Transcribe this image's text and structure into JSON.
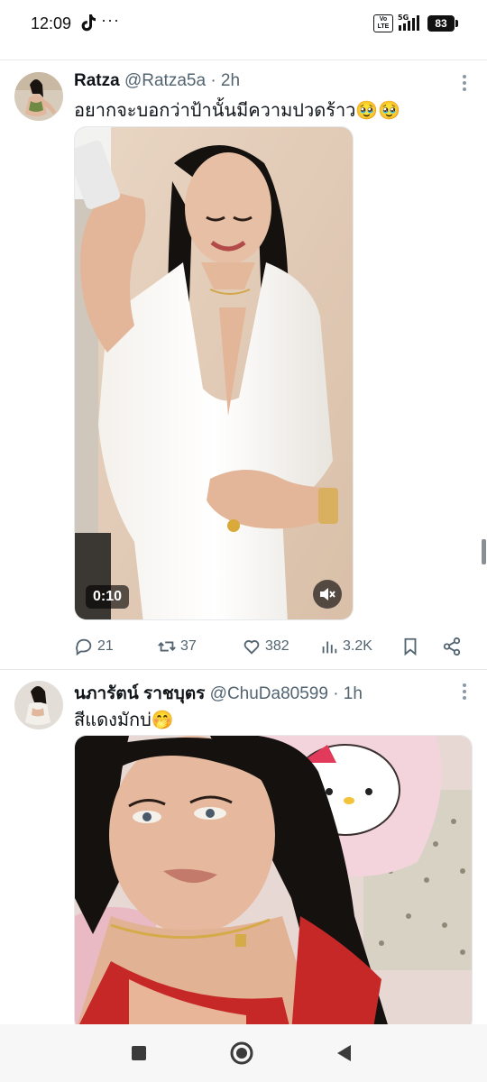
{
  "status_bar": {
    "time": "12:09",
    "app_icon": "tiktok-icon",
    "more_dots": "···",
    "volte": "Vo\nLTE",
    "network": "5G",
    "battery": "83"
  },
  "tweets": [
    {
      "name": "Ratza",
      "handle": "@Ratza5a",
      "time": "· 2h",
      "text": "อยากจะบอกว่าป้านั้นมีความปวดร้าว🥹🥹",
      "media": {
        "type": "video",
        "duration": "0:10",
        "muted": true
      },
      "actions": {
        "replies": "21",
        "retweets": "37",
        "likes": "382",
        "views": "3.2K"
      }
    },
    {
      "name": "นภารัตน์ ราชบุตร",
      "handle": "@ChuDa80599",
      "time": "· 1h",
      "text": "สีแดงมักบ่🤭",
      "media": {
        "type": "image"
      }
    }
  ],
  "colors": {
    "text_primary": "#0f1419",
    "text_secondary": "#536471",
    "divider": "#e6e9ec"
  }
}
